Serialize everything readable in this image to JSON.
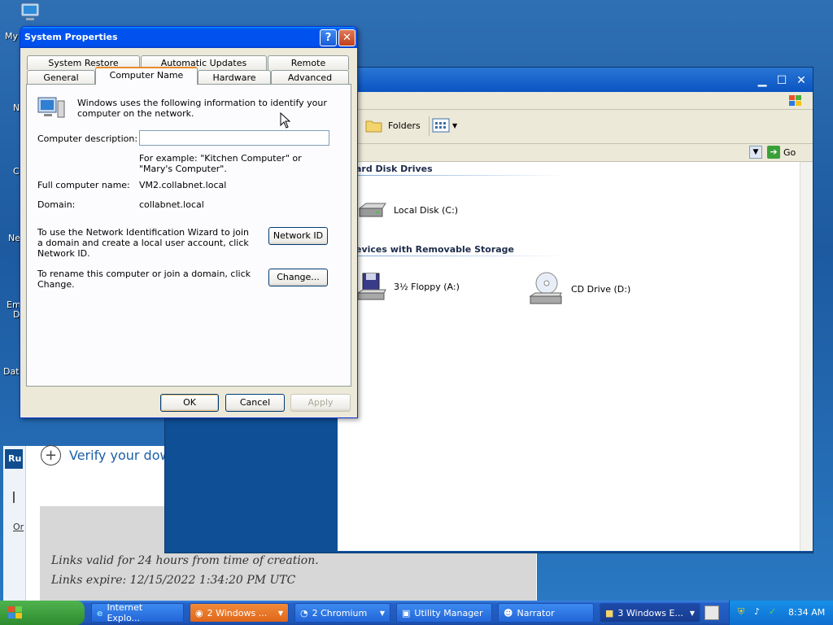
{
  "desktop": {
    "labels": [
      "My",
      "N",
      "C",
      "Ne",
      "Em",
      "D",
      "Data"
    ]
  },
  "browser": {
    "run_label": "Ru",
    "side_label": "Or",
    "verify_heading": "Verify your down",
    "link_line1": "Links valid for 24 hours from time of creation.",
    "link_line2": "Links expire: 12/15/2022 1:34:20 PM UTC"
  },
  "explorer": {
    "folders_label": "Folders",
    "go_label": "Go",
    "section_hdd": "ard Disk Drives",
    "section_removable": "evices with Removable Storage",
    "drives": [
      "Local Disk (C:)",
      "3½ Floppy (A:)",
      "CD Drive (D:)"
    ]
  },
  "dialog": {
    "title": "System Properties",
    "help_glyph": "?",
    "close_glyph": "✕",
    "tabs_top": [
      "System Restore",
      "Automatic Updates",
      "Remote"
    ],
    "tabs_bottom": [
      "General",
      "Computer Name",
      "Hardware",
      "Advanced"
    ],
    "intro": "Windows uses the following information to identify your computer on the network.",
    "desc_label": "Computer description:",
    "desc_value": "",
    "example": "For example: \"Kitchen Computer\" or \"Mary's Computer\".",
    "full_name_label": "Full computer name:",
    "full_name_value": "VM2.collabnet.local",
    "domain_label": "Domain:",
    "domain_value": "collabnet.local",
    "network_text": "To use the Network Identification Wizard to join a domain and create a local user account, click Network ID.",
    "network_button": "Network ID",
    "rename_text": "To rename this computer or join a domain, click Change.",
    "change_button": "Change...",
    "ok": "OK",
    "cancel": "Cancel",
    "apply": "Apply"
  },
  "taskbar": {
    "items": [
      "Internet Explo...",
      "2 Windows ...",
      "2 Chromium",
      "Utility Manager",
      "Narrator",
      "3 Windows E..."
    ],
    "time": "8:34 AM"
  }
}
